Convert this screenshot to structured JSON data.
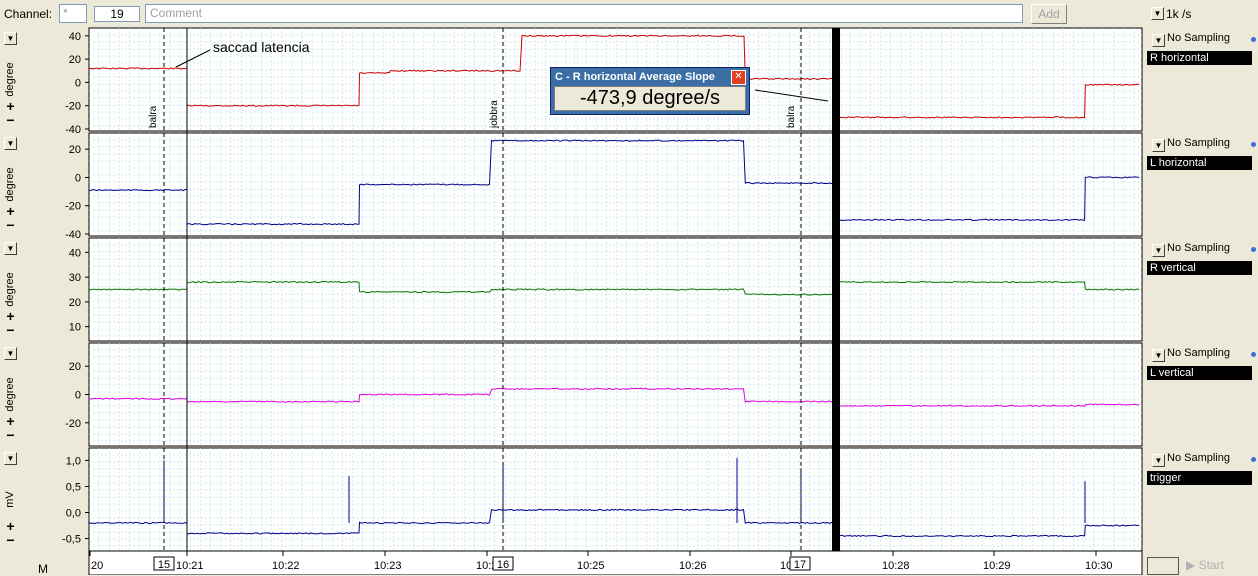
{
  "toolbar": {
    "channel_label": "Channel:",
    "channel_select": "*",
    "channel_number": "19",
    "comment_placeholder": "Comment",
    "add_button": "Add",
    "rate": "1k /s"
  },
  "channels": [
    {
      "name": "R horizontal",
      "sampling": "No Sampling",
      "unit": "degree",
      "ticks": [
        "40",
        "20",
        "0",
        "-20",
        "-40"
      ],
      "color": "#cc0000"
    },
    {
      "name": "L horizontal",
      "sampling": "No Sampling",
      "unit": "degree",
      "ticks": [
        "20",
        "0",
        "-20",
        "-40"
      ],
      "color": "#00008b"
    },
    {
      "name": "R vertical",
      "sampling": "No Sampling",
      "unit": "degree",
      "ticks": [
        "40",
        "30",
        "20",
        "10"
      ],
      "color": "#007700"
    },
    {
      "name": "L vertical",
      "sampling": "No Sampling",
      "unit": "degree",
      "ticks": [
        "20",
        "0",
        "-20"
      ],
      "color": "#dd00dd"
    },
    {
      "name": "trigger",
      "sampling": "No Sampling",
      "unit": "mV",
      "ticks": [
        "1,0",
        "0,5",
        "0,0",
        "-0,5"
      ],
      "color": "#00008b"
    }
  ],
  "annotations": {
    "saccade_label": "saccad latencia",
    "markers": [
      "balra",
      "jobbra",
      "balra"
    ]
  },
  "popup": {
    "title": "C - R horizontal Average Slope",
    "value": "-473,9 degree/s"
  },
  "time_axis": {
    "labels": [
      "20",
      "10:21",
      "10:22",
      "10:23",
      "10:24",
      "10:25",
      "10:26",
      "10:27",
      "10:28",
      "10:29",
      "10:30"
    ],
    "event_numbers": [
      "15",
      "16",
      "17"
    ]
  },
  "bottom": {
    "mode_label": "M",
    "start_label": "Start"
  },
  "chart_data": {
    "type": "line",
    "x_unit": "time (hh:mm)",
    "series": [
      {
        "name": "R horizontal",
        "unit": "degree",
        "ylim": [
          -40,
          45
        ],
        "segments": [
          [
            10.0,
            10.21,
            12
          ],
          [
            10.21,
            10.227,
            -20
          ],
          [
            10.227,
            10.23,
            8
          ],
          [
            10.23,
            10.243,
            10
          ],
          [
            10.243,
            10.265,
            40
          ],
          [
            10.265,
            10.274,
            3
          ],
          [
            10.274,
            10.2985,
            -30
          ],
          [
            10.2985,
            10.304,
            -2
          ]
        ]
      },
      {
        "name": "L horizontal",
        "unit": "degree",
        "ylim": [
          -40,
          30
        ],
        "segments": [
          [
            10.0,
            10.21,
            -9
          ],
          [
            10.21,
            10.227,
            -33
          ],
          [
            10.227,
            10.24,
            -5
          ],
          [
            10.24,
            10.265,
            26
          ],
          [
            10.265,
            10.274,
            -4
          ],
          [
            10.274,
            10.2985,
            -30
          ],
          [
            10.2985,
            10.304,
            0
          ]
        ]
      },
      {
        "name": "R vertical",
        "unit": "degree",
        "ylim": [
          5,
          45
        ],
        "segments": [
          [
            10.0,
            10.21,
            25
          ],
          [
            10.21,
            10.227,
            28
          ],
          [
            10.227,
            10.24,
            24
          ],
          [
            10.24,
            10.265,
            25
          ],
          [
            10.265,
            10.274,
            23
          ],
          [
            10.274,
            10.2985,
            28
          ],
          [
            10.2985,
            10.304,
            25
          ]
        ]
      },
      {
        "name": "L vertical",
        "unit": "degree",
        "ylim": [
          -35,
          35
        ],
        "segments": [
          [
            10.0,
            10.21,
            -3
          ],
          [
            10.21,
            10.227,
            -5
          ],
          [
            10.227,
            10.24,
            0
          ],
          [
            10.24,
            10.265,
            4
          ],
          [
            10.265,
            10.274,
            -5
          ],
          [
            10.274,
            10.2985,
            -8
          ],
          [
            10.2985,
            10.304,
            -7
          ]
        ]
      },
      {
        "name": "trigger",
        "unit": "mV",
        "ylim": [
          -0.7,
          1.2
        ],
        "segments": [
          [
            10.0,
            10.21,
            -0.2
          ],
          [
            10.21,
            10.227,
            -0.4
          ],
          [
            10.227,
            10.24,
            -0.2
          ],
          [
            10.24,
            10.265,
            0.05
          ],
          [
            10.265,
            10.274,
            -0.2
          ],
          [
            10.274,
            10.2985,
            -0.45
          ],
          [
            10.2985,
            10.304,
            -0.25
          ]
        ]
      }
    ]
  }
}
